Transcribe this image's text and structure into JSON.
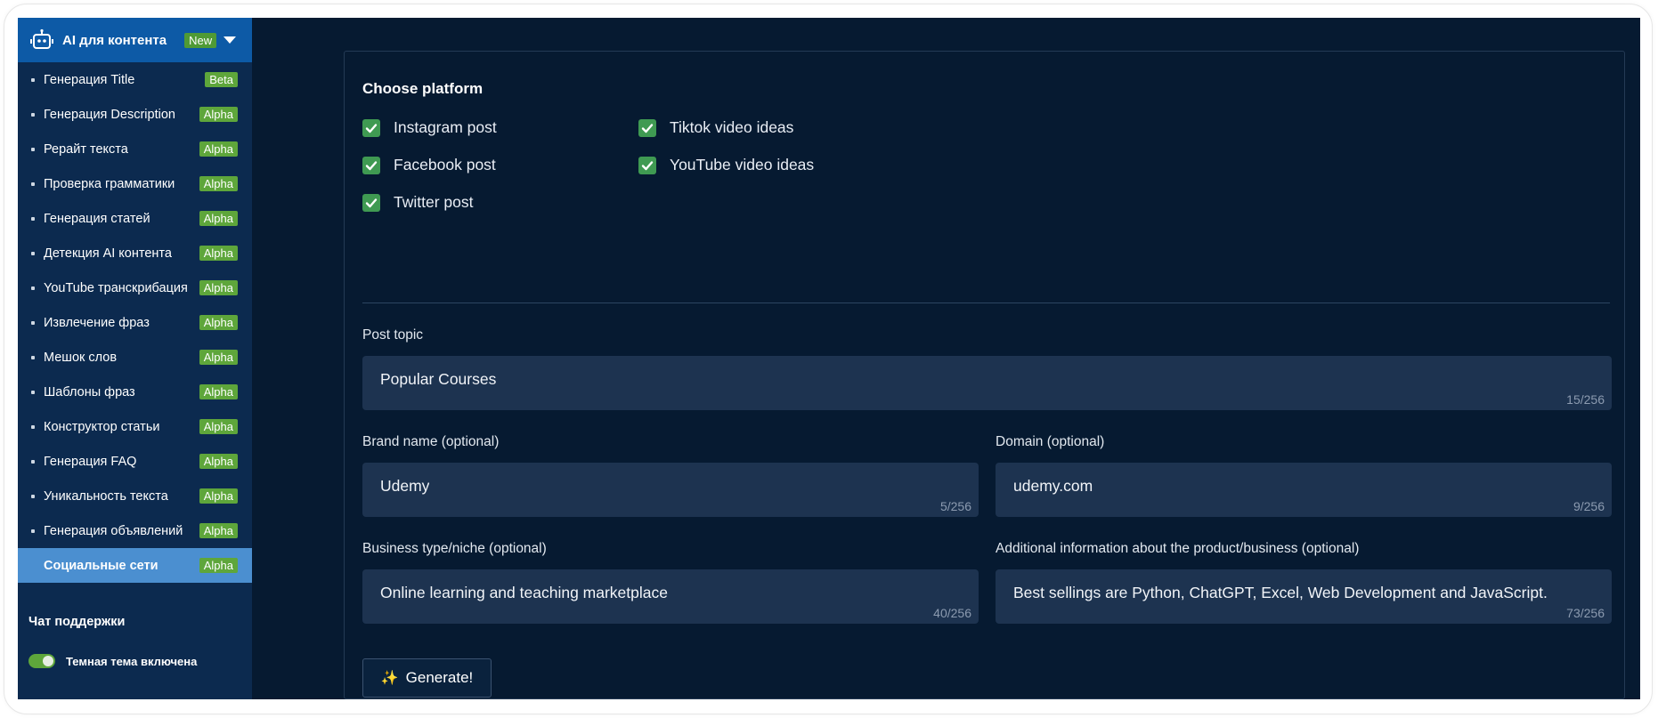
{
  "sidebar": {
    "header": {
      "title": "AI для контента",
      "badge": "New",
      "icon": "robot-icon"
    },
    "items": [
      {
        "label": "Генерация Title",
        "badge": "Beta"
      },
      {
        "label": "Генерация Description",
        "badge": "Alpha"
      },
      {
        "label": "Рерайт текста",
        "badge": "Alpha"
      },
      {
        "label": "Проверка грамматики",
        "badge": "Alpha"
      },
      {
        "label": "Генерация статей",
        "badge": "Alpha"
      },
      {
        "label": "Детекция AI контента",
        "badge": "Alpha"
      },
      {
        "label": "YouTube транскрибация",
        "badge": "Alpha"
      },
      {
        "label": "Извлечение фраз",
        "badge": "Alpha"
      },
      {
        "label": "Мешок слов",
        "badge": "Alpha"
      },
      {
        "label": "Шаблоны фраз",
        "badge": "Alpha"
      },
      {
        "label": "Конструктор статьи",
        "badge": "Alpha"
      },
      {
        "label": "Генерация FAQ",
        "badge": "Alpha"
      },
      {
        "label": "Уникальность текста",
        "badge": "Alpha"
      },
      {
        "label": "Генерация объявлений",
        "badge": "Alpha"
      },
      {
        "label": "Социальные сети",
        "badge": "Alpha",
        "active": true
      }
    ],
    "support": "Чат поддержки",
    "theme_toggle": "Темная тема включена"
  },
  "platform": {
    "title": "Choose platform",
    "options": [
      {
        "label": "Instagram post",
        "checked": true
      },
      {
        "label": "Facebook post",
        "checked": true
      },
      {
        "label": "Twitter post",
        "checked": true
      },
      {
        "label": "Tiktok video ideas",
        "checked": true
      },
      {
        "label": "YouTube video ideas",
        "checked": true
      }
    ]
  },
  "form": {
    "post_topic": {
      "label": "Post topic",
      "value": "Popular Courses",
      "counter": "15/256"
    },
    "brand_name": {
      "label": "Brand name (optional)",
      "value": "Udemy",
      "counter": "5/256"
    },
    "domain": {
      "label": "Domain (optional)",
      "value": "udemy.com",
      "counter": "9/256"
    },
    "business_type": {
      "label": "Business type/niche (optional)",
      "value": "Online learning and teaching marketplace",
      "counter": "40/256"
    },
    "additional_info": {
      "label": "Additional information about the product/business (optional)",
      "value": "Best sellings are Python, ChatGPT, Excel, Web Development and JavaScript.",
      "counter": "73/256"
    },
    "generate_label": "Generate!",
    "generate_icon": "sparkles-icon"
  },
  "colors": {
    "background": "#061a31",
    "sidebar": "#0c2a4f",
    "sidebar_header": "#0d5aa6",
    "active_item": "#4b8fd0",
    "badge_green": "#5ea63b",
    "checkbox": "#3f9a52",
    "field": "#1d3350"
  }
}
